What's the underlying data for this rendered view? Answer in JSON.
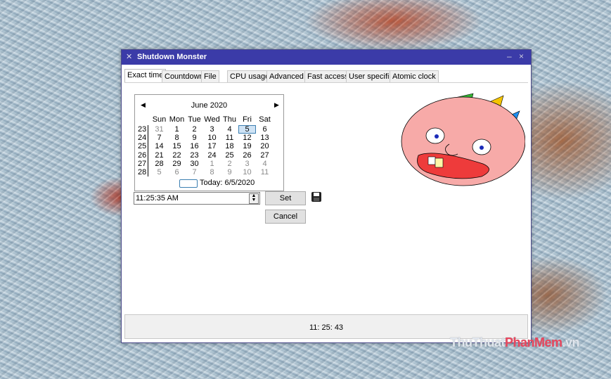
{
  "window": {
    "title": "Shutdown Monster",
    "icon": "monster-icon",
    "minimize": "–",
    "close": "×"
  },
  "tabs": [
    {
      "label": "Exact time",
      "active": true
    },
    {
      "label": "Countdown"
    },
    {
      "label": "File"
    },
    {
      "label": "CPU usage"
    },
    {
      "label": "Advanced"
    },
    {
      "label": "Fast access"
    },
    {
      "label": "User specific"
    },
    {
      "label": "Atomic clock"
    }
  ],
  "calendar": {
    "month": "June 2020",
    "prev": "◀",
    "next": "▶",
    "weekdays": [
      "Sun",
      "Mon",
      "Tue",
      "Wed",
      "Thu",
      "Fri",
      "Sat"
    ],
    "weeks": [
      "23",
      "24",
      "25",
      "26",
      "27",
      "28"
    ],
    "rows": [
      [
        "31",
        "1",
        "2",
        "3",
        "4",
        "5",
        "6"
      ],
      [
        "7",
        "8",
        "9",
        "10",
        "11",
        "12",
        "13"
      ],
      [
        "14",
        "15",
        "16",
        "17",
        "18",
        "19",
        "20"
      ],
      [
        "21",
        "22",
        "23",
        "24",
        "25",
        "26",
        "27"
      ],
      [
        "28",
        "29",
        "30",
        "1",
        "2",
        "3",
        "4"
      ],
      [
        "5",
        "6",
        "7",
        "8",
        "9",
        "10",
        "11"
      ]
    ],
    "selected": "5",
    "today": "Today: 6/5/2020"
  },
  "time_input": {
    "value": "11:25:35 AM",
    "spin": "▲▼"
  },
  "buttons": {
    "set": "Set",
    "cancel": "Cancel"
  },
  "status": {
    "clock": "11: 25: 43"
  },
  "watermark": {
    "part1": "ThuThuat",
    "part2": "PhanMem",
    "part3": ".vn"
  }
}
